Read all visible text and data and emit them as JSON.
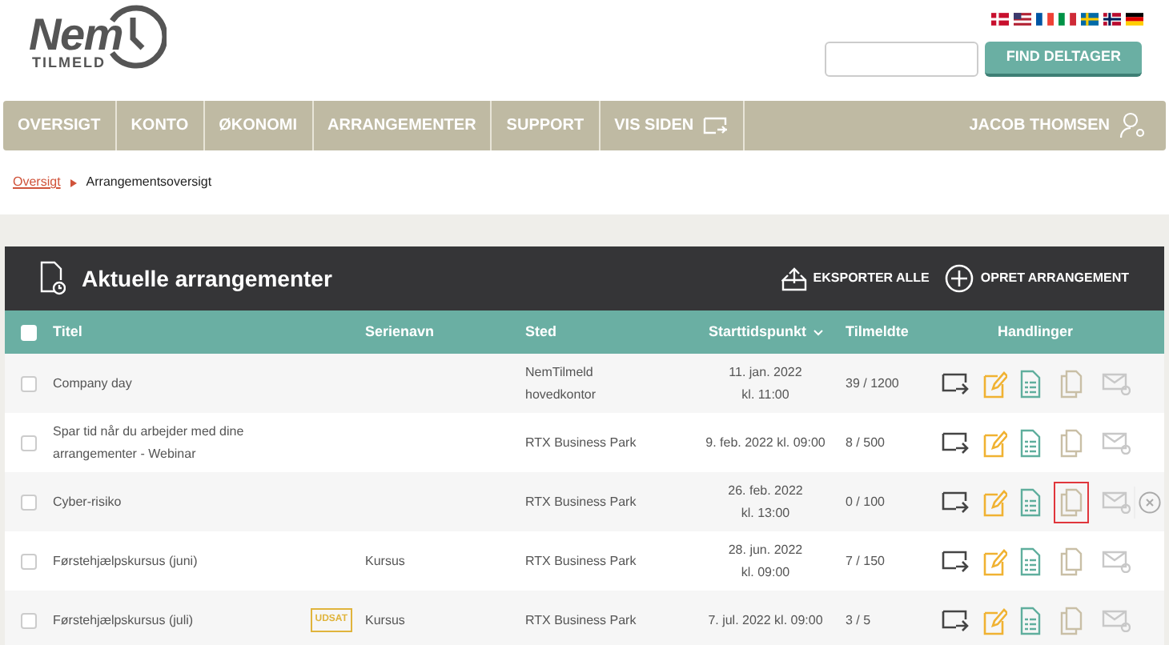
{
  "logo": {
    "name": "Nem",
    "sub": "TILMELD"
  },
  "search": {
    "button": "FIND DELTAGER"
  },
  "nav": {
    "items": [
      {
        "label": "OVERSIGT",
        "kind": "link"
      },
      {
        "label": "KONTO",
        "kind": "link"
      },
      {
        "label": "ØKONOMI",
        "kind": "link"
      },
      {
        "label": "ARRANGEMENTER",
        "kind": "link"
      },
      {
        "label": "SUPPORT",
        "kind": "link"
      },
      {
        "label": "VIS SIDEN",
        "kind": "external"
      }
    ],
    "user": "JACOB THOMSEN"
  },
  "breadcrumb": [
    "Oversigt",
    "Arrangementsoversigt"
  ],
  "card": {
    "title": "Aktuelle arrangementer",
    "actions": [
      {
        "label": "EKSPORTER ALLE",
        "kind": "export"
      },
      {
        "label": "OPRET ARRANGEMENT",
        "kind": "create"
      }
    ]
  },
  "table": {
    "select_all_checked": false,
    "columns": [
      {
        "label": "Titel",
        "sorted": false
      },
      {
        "label": "Serienavn",
        "sorted": false
      },
      {
        "label": "Sted",
        "sorted": false
      },
      {
        "label": "Starttidspunkt",
        "sorted": true
      },
      {
        "label": "Tilmeldte",
        "sorted": false
      },
      {
        "label": "Handlinger",
        "sorted": false
      }
    ],
    "rows": [
      {
        "title": "Company day",
        "place": "NemTilmeld hovedkontor",
        "start": [
          "11. jan. 2022",
          "kl. 11:00"
        ],
        "count": "39 / 1200",
        "checked": false,
        "copy_highlighted": false,
        "removable": false
      },
      {
        "title": "Spar tid når du arbejder med dine arrangementer - Webinar",
        "place": "RTX Business Park",
        "start": [
          "9. feb. 2022 kl. 09:00"
        ],
        "count": "8 / 500",
        "checked": false,
        "copy_highlighted": false,
        "removable": false
      },
      {
        "title": "Cyber-risiko",
        "place": "RTX Business Park",
        "start": [
          "26. feb. 2022",
          "kl. 13:00"
        ],
        "count": "0 / 100",
        "checked": false,
        "copy_highlighted": true,
        "removable": true
      },
      {
        "title": "Førstehjælpskursus (juni)",
        "series": "Kursus",
        "place": "RTX Business Park",
        "start": [
          "28. jun. 2022",
          "kl. 09:00"
        ],
        "count": "7 / 150",
        "checked": false,
        "copy_highlighted": false,
        "removable": false
      },
      {
        "title": "Førstehjælpskursus (juli)",
        "badge": "UDSAT",
        "series": "Kursus",
        "place": "RTX Business Park",
        "start": [
          "7. jul. 2022 kl. 09:00"
        ],
        "count": "3 / 5",
        "checked": false,
        "copy_highlighted": false,
        "removable": false
      }
    ]
  }
}
